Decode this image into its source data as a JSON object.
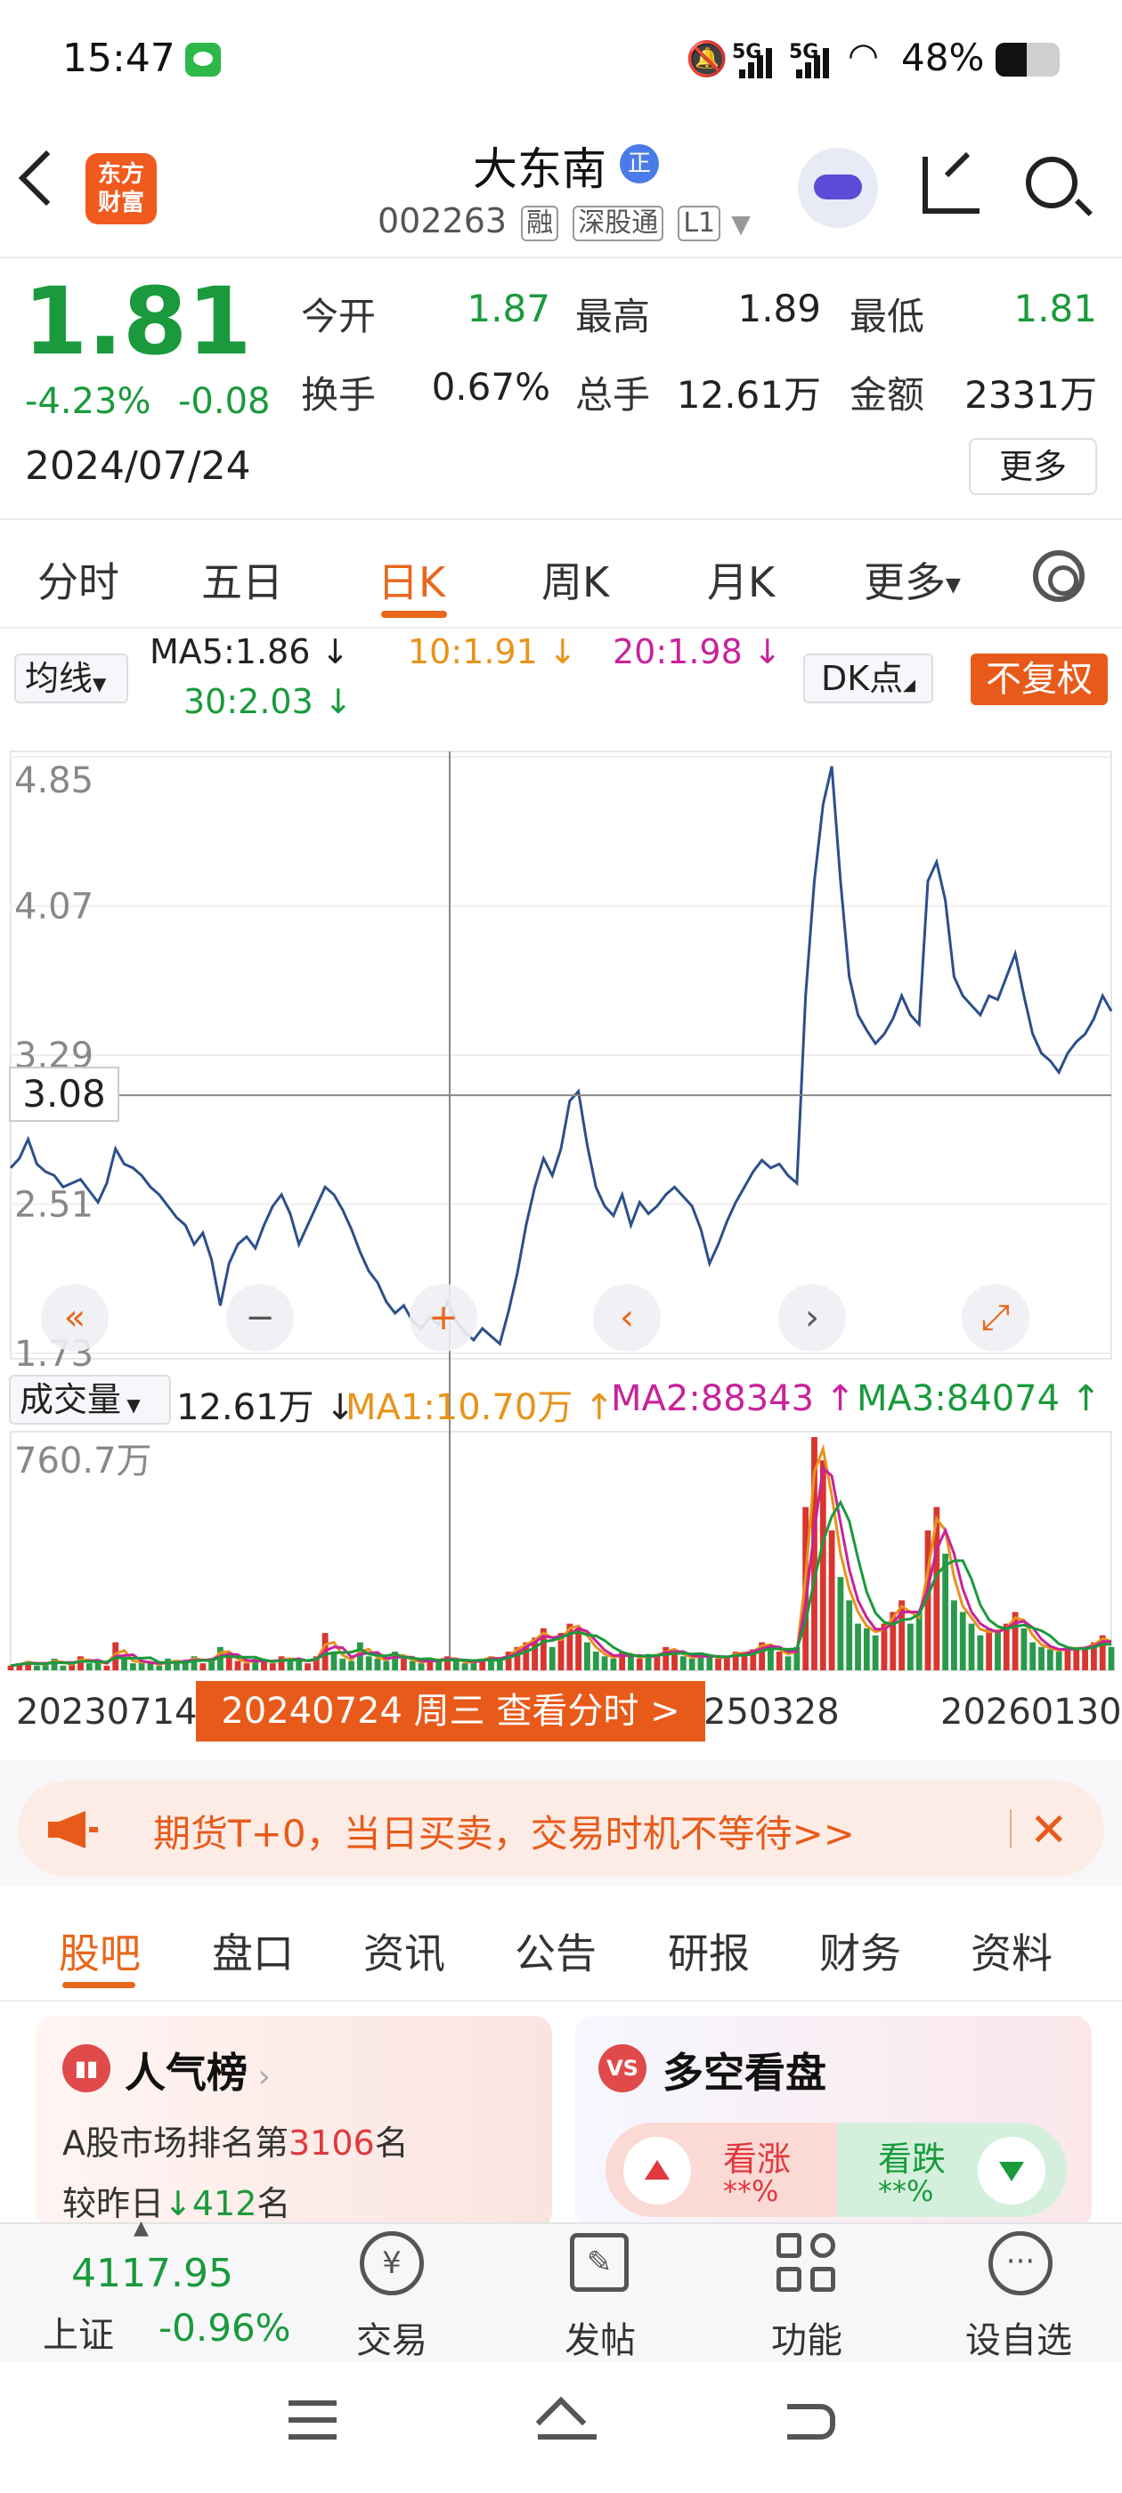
{
  "status_bar": {
    "time": "15:47",
    "signal1": "5G",
    "signal2": "5G",
    "battery": "48%",
    "battery_level": 0.48
  },
  "header": {
    "logo_text_line1": "东方",
    "logo_text_line2": "财富",
    "title": "大东南",
    "title_badge": "正",
    "code": "002263",
    "tags": [
      "融",
      "深股通",
      "L1"
    ]
  },
  "quote": {
    "price": "1.81",
    "change_pct": "-4.23%",
    "change": "-0.08",
    "date": "2024/07/24",
    "stats": [
      {
        "label": "今开",
        "value": "1.87",
        "color": "#1a9a3c"
      },
      {
        "label": "最高",
        "value": "1.89",
        "color": "#222222"
      },
      {
        "label": "最低",
        "value": "1.81",
        "color": "#1a9a3c"
      },
      {
        "label": "换手",
        "value": "0.67%",
        "color": "#222222"
      },
      {
        "label": "总手",
        "value": "12.61万",
        "color": "#222222"
      },
      {
        "label": "金额",
        "value": "2331万",
        "color": "#222222"
      }
    ],
    "more_label": "更多"
  },
  "period_tabs": [
    "分时",
    "五日",
    "日K",
    "周K",
    "月K",
    "更多"
  ],
  "active_period_tab": "日K",
  "ma_bar": {
    "select_label": "均线",
    "ma5": "MA5:1.86 ↓",
    "ma10": "10:1.91 ↓",
    "ma20": "20:1.98 ↓",
    "ma30": "30:2.03 ↓",
    "dk_label": "DK点",
    "fq_label": "不复权"
  },
  "chart_data": {
    "type": "line",
    "ylim": [
      1.73,
      4.85
    ],
    "y_ticks": [
      "4.85",
      "4.07",
      "3.29",
      "2.51",
      "1.73"
    ],
    "crosshair_value": "3.08",
    "x_labels": [
      "20230714",
      "250328",
      "20260130"
    ],
    "selected_date_label": "20240724 周三 查看分时 >",
    "price": [
      2.7,
      2.75,
      2.85,
      2.72,
      2.68,
      2.66,
      2.6,
      2.62,
      2.64,
      2.58,
      2.52,
      2.62,
      2.8,
      2.72,
      2.7,
      2.66,
      2.6,
      2.56,
      2.5,
      2.44,
      2.4,
      2.3,
      2.36,
      2.22,
      1.98,
      2.2,
      2.3,
      2.34,
      2.28,
      2.4,
      2.5,
      2.56,
      2.46,
      2.3,
      2.4,
      2.5,
      2.6,
      2.56,
      2.48,
      2.38,
      2.26,
      2.16,
      2.1,
      2.0,
      1.94,
      1.98,
      1.9,
      1.86,
      1.92,
      1.88,
      2.0,
      1.9,
      1.84,
      1.8,
      1.86,
      1.82,
      1.78,
      1.95,
      2.15,
      2.4,
      2.6,
      2.75,
      2.66,
      2.8,
      3.05,
      3.1,
      2.82,
      2.6,
      2.5,
      2.45,
      2.56,
      2.4,
      2.52,
      2.46,
      2.5,
      2.56,
      2.6,
      2.55,
      2.5,
      2.38,
      2.2,
      2.3,
      2.42,
      2.52,
      2.6,
      2.68,
      2.74,
      2.7,
      2.72,
      2.66,
      2.62,
      3.6,
      4.2,
      4.6,
      4.8,
      4.2,
      3.7,
      3.5,
      3.42,
      3.35,
      3.4,
      3.48,
      3.6,
      3.5,
      3.45,
      4.2,
      4.3,
      4.1,
      3.7,
      3.6,
      3.55,
      3.5,
      3.6,
      3.58,
      3.7,
      3.82,
      3.6,
      3.4,
      3.3,
      3.26,
      3.2,
      3.3,
      3.36,
      3.4,
      3.48,
      3.6,
      3.52
    ],
    "volume": [
      0.02,
      0.03,
      0.04,
      0.02,
      0.03,
      0.05,
      0.02,
      0.03,
      0.06,
      0.03,
      0.04,
      0.02,
      0.12,
      0.05,
      0.03,
      0.04,
      0.03,
      0.02,
      0.05,
      0.03,
      0.04,
      0.06,
      0.03,
      0.05,
      0.1,
      0.06,
      0.04,
      0.03,
      0.05,
      0.04,
      0.03,
      0.06,
      0.04,
      0.05,
      0.03,
      0.06,
      0.16,
      0.08,
      0.05,
      0.04,
      0.12,
      0.06,
      0.05,
      0.04,
      0.08,
      0.05,
      0.04,
      0.03,
      0.05,
      0.04,
      0.06,
      0.04,
      0.03,
      0.04,
      0.05,
      0.06,
      0.04,
      0.08,
      0.1,
      0.12,
      0.14,
      0.18,
      0.1,
      0.16,
      0.2,
      0.18,
      0.12,
      0.08,
      0.06,
      0.05,
      0.08,
      0.06,
      0.05,
      0.07,
      0.06,
      0.1,
      0.08,
      0.06,
      0.05,
      0.07,
      0.06,
      0.05,
      0.06,
      0.08,
      0.07,
      0.09,
      0.12,
      0.1,
      0.08,
      0.06,
      0.1,
      0.7,
      1.0,
      0.9,
      0.6,
      0.4,
      0.3,
      0.2,
      0.18,
      0.15,
      0.2,
      0.25,
      0.3,
      0.2,
      0.25,
      0.6,
      0.7,
      0.5,
      0.3,
      0.25,
      0.2,
      0.15,
      0.18,
      0.16,
      0.2,
      0.25,
      0.18,
      0.12,
      0.1,
      0.09,
      0.08,
      0.1,
      0.09,
      0.1,
      0.12,
      0.15,
      0.1
    ],
    "volume_max_label": "760.7万"
  },
  "volume_bar": {
    "select_label": "成交量",
    "vol": "12.61万 ↓",
    "ma1": "MA1:10.70万 ↑",
    "ma2": "MA2:88343 ↑",
    "ma3": "MA3:84074 ↑"
  },
  "banner": {
    "text": "期货T+0，当日买卖，交易时机不等待>>"
  },
  "lower_tabs": [
    "股吧",
    "盘口",
    "资讯",
    "公告",
    "研报",
    "财务",
    "资料"
  ],
  "active_lower_tab": "股吧",
  "cards": {
    "popularity": {
      "title": "人气榜",
      "line1_prefix": "A股市场排名第",
      "line1_rank": "3106",
      "line1_suffix": "名",
      "line2_prefix": "较昨日",
      "line2_change": "412",
      "line2_suffix": "名"
    },
    "sentiment": {
      "icon_text": "VS",
      "title": "多空看盘",
      "bull_label": "看涨",
      "bull_value": "**%",
      "bear_label": "看跌",
      "bear_value": "**%"
    }
  },
  "bottom_bar": {
    "index_value": "4117.95",
    "index_name": "上证",
    "index_change": "-0.96%",
    "items": [
      "交易",
      "发帖",
      "功能",
      "设自选"
    ]
  }
}
